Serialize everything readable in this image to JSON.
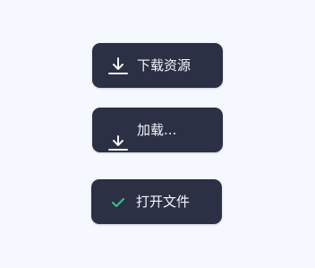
{
  "buttons": {
    "download": {
      "label": "下载资源",
      "icon": "download-icon"
    },
    "loading": {
      "label": "加载...",
      "icon": "download-icon"
    },
    "open": {
      "label": "打开文件",
      "icon": "check-icon"
    }
  },
  "colors": {
    "background": "#f5f8ff",
    "button": "#2b3045",
    "text": "#f4f5fa",
    "check": "#2ec98a"
  }
}
